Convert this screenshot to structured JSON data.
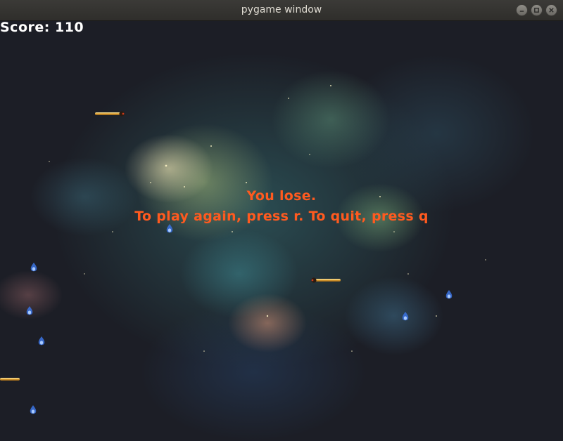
{
  "window": {
    "title": "pygame window"
  },
  "hud": {
    "score_text": "Score: 110"
  },
  "game_over": {
    "line1": "You lose.",
    "line2": "To play again, press r. To quit, press q"
  },
  "colors": {
    "message": "#ff5a1f",
    "score": "#ffffff",
    "titlebar": "#3b3a37",
    "space_background": "#1c1e26"
  },
  "icons": {
    "minimize": "minimize-icon",
    "maximize": "maximize-icon",
    "close": "close-icon",
    "missile": "missile-sprite",
    "enemy": "blue-flame-enemy-sprite"
  }
}
